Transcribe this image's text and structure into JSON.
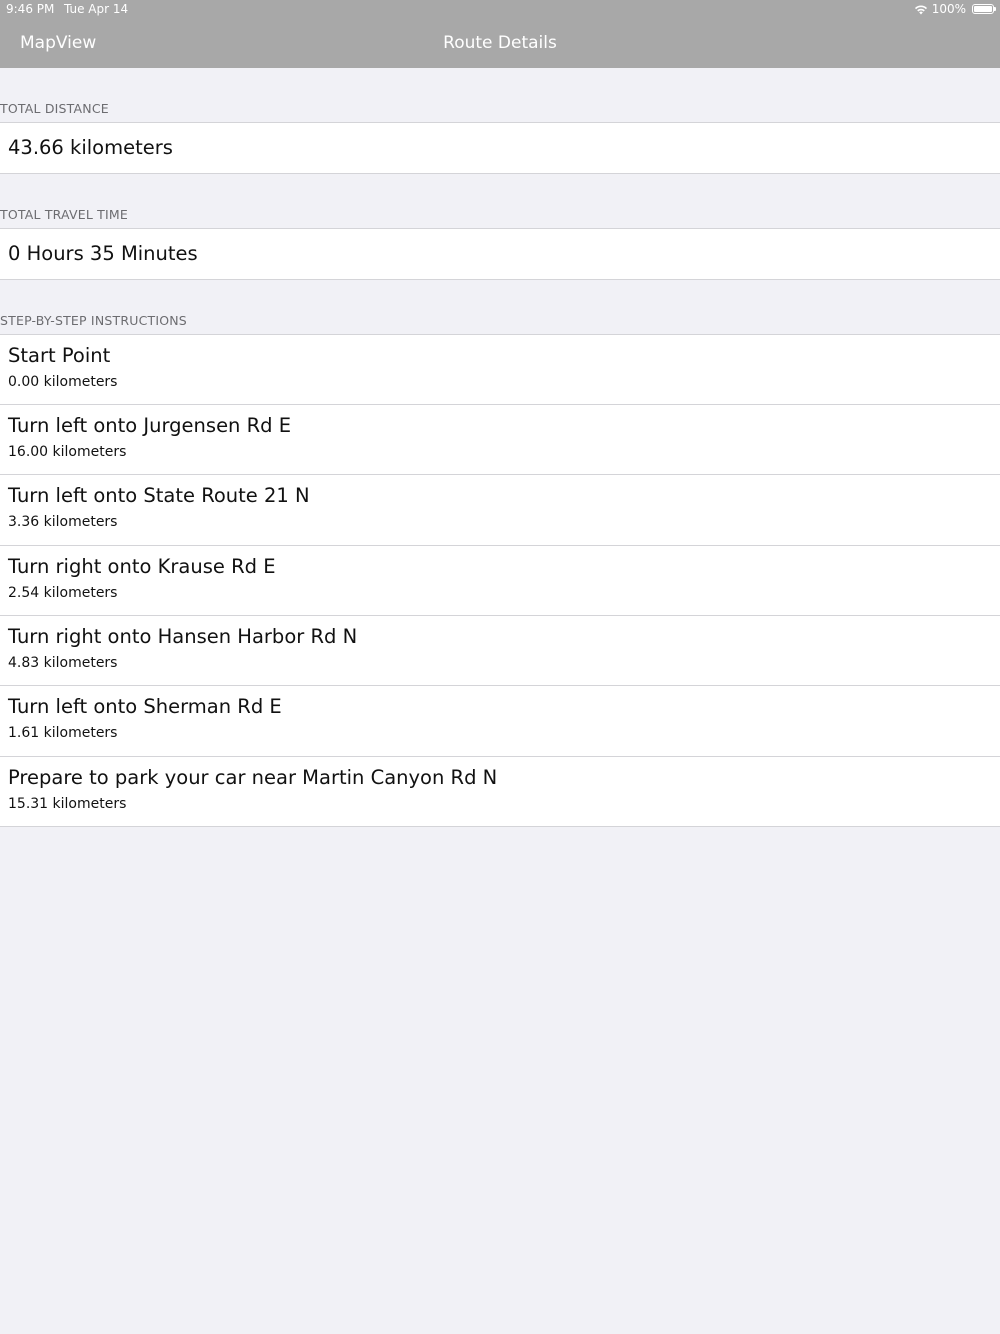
{
  "status_bar": {
    "time": "9:46 PM",
    "date": "Tue Apr 14",
    "battery_text": "100%",
    "battery_level": 1.0
  },
  "nav": {
    "back_label": "MapView",
    "title": "Route Details"
  },
  "sections": {
    "distance_header": "TOTAL DISTANCE",
    "distance_value": "43.66 kilometers",
    "time_header": "TOTAL TRAVEL TIME",
    "time_value": "0 Hours 35 Minutes",
    "steps_header": "STEP-BY-STEP INSTRUCTIONS"
  },
  "steps": [
    {
      "instruction": "Start Point",
      "distance": "0.00 kilometers"
    },
    {
      "instruction": "Turn left onto Jurgensen Rd E",
      "distance": "16.00 kilometers"
    },
    {
      "instruction": "Turn left onto State Route 21 N",
      "distance": "3.36 kilometers"
    },
    {
      "instruction": "Turn right onto Krause Rd E",
      "distance": "2.54 kilometers"
    },
    {
      "instruction": "Turn right onto Hansen Harbor Rd N",
      "distance": "4.83 kilometers"
    },
    {
      "instruction": "Turn left onto Sherman Rd E",
      "distance": "1.61 kilometers"
    },
    {
      "instruction": "Prepare to park your car near Martin Canyon Rd N",
      "distance": "15.31 kilometers"
    }
  ],
  "colors": {
    "nav_bar": "#a8a8a8",
    "background": "#f1f1f6",
    "cell": "#ffffff",
    "separator": "#d4d4d8",
    "section_header_text": "#6c6c70"
  },
  "icons": [
    "wifi-icon",
    "battery-icon"
  ]
}
